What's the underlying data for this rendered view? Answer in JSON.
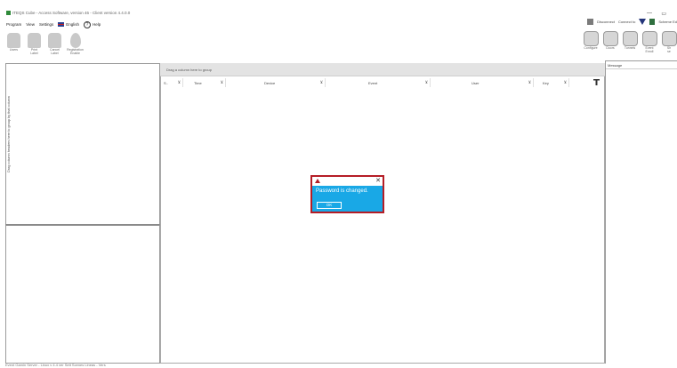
{
  "window": {
    "title": "ITEQS Cube - Access Software, version 46 - Client version 4.4.0.0",
    "minimize": "—",
    "maximize": "▭"
  },
  "menu": {
    "items": [
      "Program",
      "View",
      "Settings"
    ],
    "language": "English",
    "help": "Help"
  },
  "toolbar": {
    "tools": [
      {
        "label": "Users",
        "icon": "users-icon"
      },
      {
        "label": "Print\nLabel",
        "icon": "print-label-icon"
      },
      {
        "label": "Cancel\nLabel",
        "icon": "cancel-label-icon"
      },
      {
        "label": "Registration\nEnable",
        "icon": "registration-icon"
      }
    ]
  },
  "status_top": {
    "disconnect": "Disconnect",
    "connected": "Connect to",
    "scheme": "Scheme Ed"
  },
  "big_tools": [
    {
      "label": "Configure",
      "icon": "configure-icon"
    },
    {
      "label": "Doors",
      "icon": "doors-icon"
    },
    {
      "label": "Tunnels",
      "icon": "tunnels-icon"
    },
    {
      "label": "Event\nEnroll",
      "icon": "event-enroll-icon"
    },
    {
      "label": "Sh\nse",
      "icon": "show-icon"
    }
  ],
  "left_panel": {
    "vertical_label": "Drag column headers here to group by that column"
  },
  "main": {
    "group_hint": "Drag a column here to group",
    "columns": [
      {
        "label": "S.."
      },
      {
        "label": "Time"
      },
      {
        "label": "Device"
      },
      {
        "label": "Event"
      },
      {
        "label": "User"
      },
      {
        "label": "Key"
      }
    ]
  },
  "right_panel": {
    "header": "Message"
  },
  "status_bar": {
    "text": "Event Gamin Server - Linux v 4.4 ver Sett Scenes Lineas - Vers"
  },
  "dialog": {
    "message": "Password is changed.",
    "ok_label": "OK",
    "close": "✕"
  },
  "colors": {
    "dialog_bg": "#19a8e6",
    "dialog_border": "#b51d26"
  }
}
